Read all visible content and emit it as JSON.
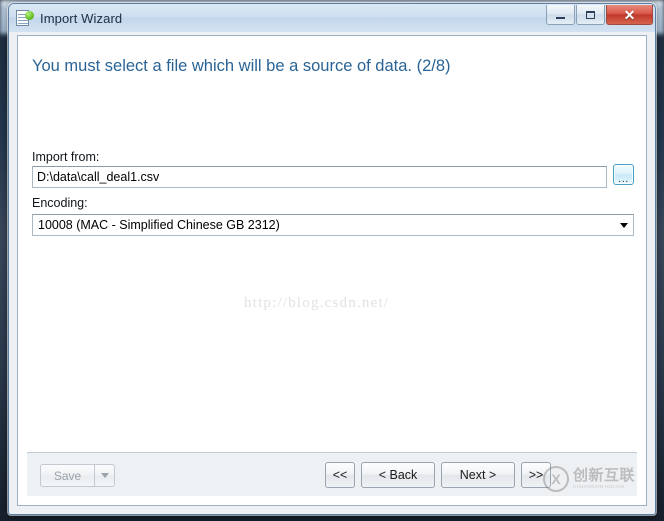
{
  "window": {
    "title": "Import Wizard",
    "app_icon": "spreadsheet-icon",
    "controls": {
      "minimize": "minimize-icon",
      "maximize": "maximize-icon",
      "close": "✕"
    }
  },
  "content": {
    "heading": "You must select a file which will be a source of data. (2/8)",
    "step_current": 2,
    "step_total": 8,
    "watermark": "http://blog.csdn.net/"
  },
  "form": {
    "import_from": {
      "label": "Import from:",
      "value": "D:\\data\\call_deal1.csv",
      "placeholder": "",
      "browse_label": "..."
    },
    "encoding": {
      "label": "Encoding:",
      "value": "10008 (MAC - Simplified Chinese GB 2312)"
    }
  },
  "footer": {
    "save_label": "Save",
    "save_enabled": false,
    "nav": {
      "first": "<<",
      "back": "< Back",
      "next": "Next >",
      "last": ">>"
    }
  },
  "brand": {
    "mark": "X",
    "name_cn": "创新互联",
    "name_en": "CHUANGXIN HULIAN"
  },
  "colors": {
    "heading": "#2a6496",
    "titlebar": "#cfdff0",
    "close_button": "#c0392b",
    "desktop": "#24384f"
  }
}
